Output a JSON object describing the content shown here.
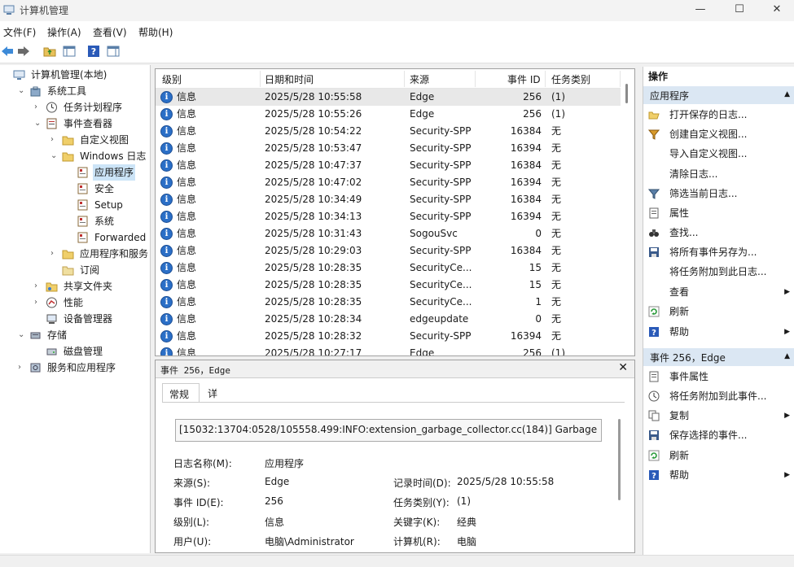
{
  "window": {
    "title": "计算机管理",
    "min": "—",
    "max": "☐",
    "close": "✕"
  },
  "menu": [
    "文件(F)",
    "操作(A)",
    "查看(V)",
    "帮助(H)"
  ],
  "tree": [
    {
      "label": "计算机管理(本地)",
      "expand": "",
      "icon": "computer-icon",
      "depth": 0
    },
    {
      "label": "系统工具",
      "expand": "▼",
      "icon": "tools-icon",
      "depth": 1
    },
    {
      "label": "任务计划程序",
      "expand": "▶",
      "icon": "clock-icon",
      "depth": 2
    },
    {
      "label": "事件查看器",
      "expand": "▼",
      "icon": "event-viewer-icon",
      "depth": 2
    },
    {
      "label": "自定义视图",
      "expand": "▶",
      "icon": "folder-icon",
      "depth": 3
    },
    {
      "label": "Windows 日志",
      "expand": "▼",
      "icon": "folder-icon",
      "depth": 3
    },
    {
      "label": "应用程序",
      "expand": "",
      "icon": "log-icon",
      "depth": 4,
      "selected": true
    },
    {
      "label": "安全",
      "expand": "",
      "icon": "log-icon",
      "depth": 4
    },
    {
      "label": "Setup",
      "expand": "",
      "icon": "log-icon",
      "depth": 4
    },
    {
      "label": "系统",
      "expand": "",
      "icon": "log-icon",
      "depth": 4
    },
    {
      "label": "Forwarded Eve",
      "expand": "",
      "icon": "log-icon",
      "depth": 4
    },
    {
      "label": "应用程序和服务日志",
      "expand": "▶",
      "icon": "folder-icon",
      "depth": 3
    },
    {
      "label": "订阅",
      "expand": "",
      "icon": "subscription-icon",
      "depth": 3
    },
    {
      "label": "共享文件夹",
      "expand": "▶",
      "icon": "shared-folder-icon",
      "depth": 2
    },
    {
      "label": "性能",
      "expand": "▶",
      "icon": "performance-icon",
      "depth": 2
    },
    {
      "label": "设备管理器",
      "expand": "",
      "icon": "device-manager-icon",
      "depth": 2
    },
    {
      "label": "存储",
      "expand": "▼",
      "icon": "storage-icon",
      "depth": 1
    },
    {
      "label": "磁盘管理",
      "expand": "",
      "icon": "disk-icon",
      "depth": 2
    },
    {
      "label": "服务和应用程序",
      "expand": "▶",
      "icon": "services-icon",
      "depth": 1
    }
  ],
  "list": {
    "columns": [
      "级别",
      "日期和时间",
      "来源",
      "事件 ID",
      "任务类别"
    ],
    "rows": [
      [
        "信息",
        "2025/5/28 10:55:58",
        "Edge",
        "256",
        "(1)"
      ],
      [
        "信息",
        "2025/5/28 10:55:26",
        "Edge",
        "256",
        "(1)"
      ],
      [
        "信息",
        "2025/5/28 10:54:22",
        "Security-SPP",
        "16384",
        "无"
      ],
      [
        "信息",
        "2025/5/28 10:53:47",
        "Security-SPP",
        "16394",
        "无"
      ],
      [
        "信息",
        "2025/5/28 10:47:37",
        "Security-SPP",
        "16384",
        "无"
      ],
      [
        "信息",
        "2025/5/28 10:47:02",
        "Security-SPP",
        "16394",
        "无"
      ],
      [
        "信息",
        "2025/5/28 10:34:49",
        "Security-SPP",
        "16384",
        "无"
      ],
      [
        "信息",
        "2025/5/28 10:34:13",
        "Security-SPP",
        "16394",
        "无"
      ],
      [
        "信息",
        "2025/5/28 10:31:43",
        "SogouSvc",
        "0",
        "无"
      ],
      [
        "信息",
        "2025/5/28 10:29:03",
        "Security-SPP",
        "16384",
        "无"
      ],
      [
        "信息",
        "2025/5/28 10:28:35",
        "SecurityCe...",
        "15",
        "无"
      ],
      [
        "信息",
        "2025/5/28 10:28:35",
        "SecurityCe...",
        "15",
        "无"
      ],
      [
        "信息",
        "2025/5/28 10:28:35",
        "SecurityCe...",
        "1",
        "无"
      ],
      [
        "信息",
        "2025/5/28 10:28:34",
        "edgeupdate",
        "0",
        "无"
      ],
      [
        "信息",
        "2025/5/28 10:28:32",
        "Security-SPP",
        "16394",
        "无"
      ],
      [
        "信息",
        "2025/5/28 10:27:17",
        "Edge",
        "256",
        "(1)"
      ]
    ]
  },
  "detail": {
    "title": "事件 256，Edge",
    "close": "✕",
    "tabs": [
      "常规",
      "详细信息"
    ],
    "description": "[15032:13704:0528/105558.499:INFO:extension_garbage_collector.cc(184)] Garbage",
    "fields": {
      "log_name_label": "日志名称(M):",
      "log_name": "应用程序",
      "source_label": "来源(S):",
      "source": "Edge",
      "logged_label": "记录时间(D):",
      "logged": "2025/5/28 10:55:58",
      "event_id_label": "事件 ID(E):",
      "event_id": "256",
      "task_label": "任务类别(Y):",
      "task": "(1)",
      "level_label": "级别(L):",
      "level": "信息",
      "keywords_label": "关键字(K):",
      "keywords": "经典",
      "user_label": "用户(U):",
      "user": "电脑\\Administrator",
      "computer_label": "计算机(R):",
      "computer": "电脑"
    }
  },
  "actions": {
    "title": "操作",
    "section1": "应用程序",
    "items1": [
      {
        "label": "打开保存的日志...",
        "icon": "open-folder-icon",
        "sub": false
      },
      {
        "label": "创建自定义视图...",
        "icon": "filter-create-icon",
        "sub": false
      },
      {
        "label": "导入自定义视图...",
        "icon": "",
        "sub": false
      },
      {
        "label": "清除日志...",
        "icon": "",
        "sub": false
      },
      {
        "label": "筛选当前日志...",
        "icon": "filter-icon",
        "sub": false
      },
      {
        "label": "属性",
        "icon": "properties-icon",
        "sub": false
      },
      {
        "label": "查找...",
        "icon": "binoculars-icon",
        "sub": false
      },
      {
        "label": "将所有事件另存为...",
        "icon": "save-icon",
        "sub": false
      },
      {
        "label": "将任务附加到此日志...",
        "icon": "",
        "sub": false
      },
      {
        "label": "查看",
        "icon": "",
        "sub": true
      },
      {
        "label": "刷新",
        "icon": "refresh-icon",
        "sub": false
      },
      {
        "label": "帮助",
        "icon": "help-icon",
        "sub": true
      }
    ],
    "section2": "事件 256，Edge",
    "items2": [
      {
        "label": "事件属性",
        "icon": "properties-icon",
        "sub": false
      },
      {
        "label": "将任务附加到此事件...",
        "icon": "task-icon",
        "sub": false
      },
      {
        "label": "复制",
        "icon": "copy-icon",
        "sub": true
      },
      {
        "label": "保存选择的事件...",
        "icon": "save-icon",
        "sub": false
      },
      {
        "label": "刷新",
        "icon": "refresh-icon",
        "sub": false
      },
      {
        "label": "帮助",
        "icon": "help-icon",
        "sub": true
      }
    ]
  },
  "colors": {
    "selection": "#cce4f7",
    "section_header": "#dbe7f3",
    "info_blue": "#2b6fc7"
  }
}
